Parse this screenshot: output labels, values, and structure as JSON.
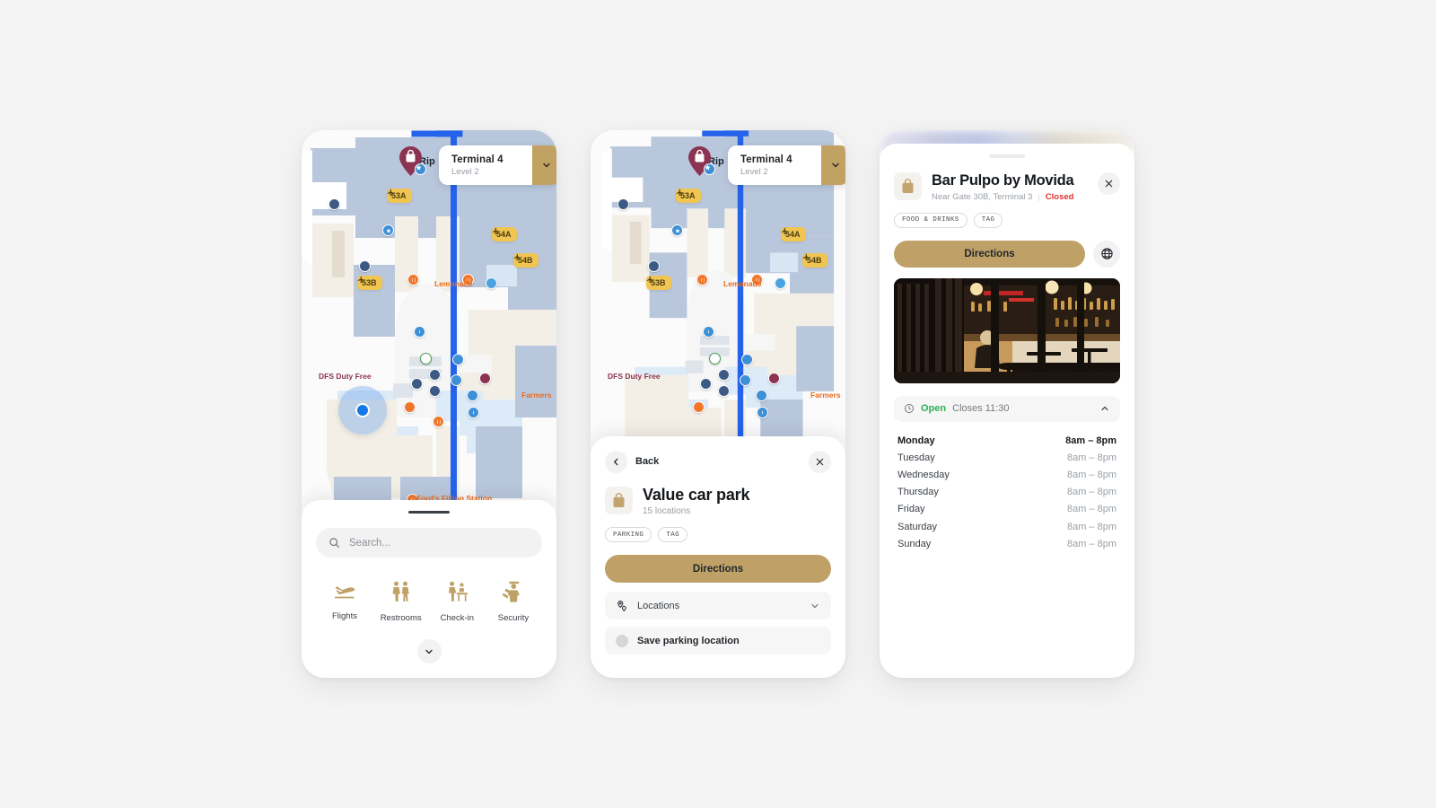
{
  "app": {
    "background": "#f4f4f4",
    "accent": "#bfa167"
  },
  "map": {
    "terminal": {
      "name": "Terminal 4",
      "level": "Level 2",
      "caret_icon": "chevron-down-icon"
    },
    "rip_label": "Rip",
    "pin_icon": "shopping-bag-pin-icon",
    "gates": [
      {
        "label": "53A",
        "icon": "plane-icon"
      },
      {
        "label": "54A",
        "icon": "plane-icon"
      },
      {
        "label": "54B",
        "icon": "plane-icon"
      },
      {
        "label": "53B",
        "icon": "plane-icon"
      }
    ],
    "labels": [
      {
        "text": "Lemonade",
        "color": "orange"
      },
      {
        "text": "DFS Duty Free",
        "color": "maroon"
      },
      {
        "text": "Farmers",
        "color": "orange"
      },
      {
        "text": "Ford's Filling Station",
        "color": "orange"
      }
    ],
    "locate_icon": "crosshair-locate-icon",
    "user_location": "you-are-here-dot"
  },
  "sheet1": {
    "search": {
      "placeholder": "Search...",
      "icon": "search-icon"
    },
    "quick_actions": [
      {
        "label": "Flights",
        "icon": "plane-landing-icon"
      },
      {
        "label": "Restrooms",
        "icon": "restrooms-icon"
      },
      {
        "label": "Check-in",
        "icon": "check-in-desk-icon"
      },
      {
        "label": "Security",
        "icon": "security-officer-icon"
      }
    ],
    "expand_icon": "chevron-down-icon"
  },
  "sheet2": {
    "back_label": "Back",
    "back_icon": "chevron-left-icon",
    "close_icon": "close-icon",
    "title": "Value car park",
    "subtitle": "15 locations",
    "thumb_icon": "shopping-bag-icon",
    "tags": [
      "PARKING",
      "TAG"
    ],
    "directions_label": "Directions",
    "locations_label": "Locations",
    "locations_icon": "map-pins-icon",
    "locations_caret": "chevron-down-icon",
    "save_parking_label": "Save parking location",
    "save_parking_toggle": "toggle-dot"
  },
  "detail": {
    "title": "Bar Pulpo by Movida",
    "location": "Near Gate 30B, Terminal 3",
    "status": "Closed",
    "status_color": "#e03232",
    "thumb_icon": "shopping-bag-icon",
    "close_icon": "close-icon",
    "tags": [
      "FOOD & DRINKS",
      "TAG"
    ],
    "directions_label": "Directions",
    "website_icon": "globe-icon",
    "photo_alt": "bar-interior-photo",
    "hours_header": {
      "clock_icon": "clock-icon",
      "state": "Open",
      "state_color": "#2db055",
      "detail": "Closes 11:30",
      "collapse_icon": "chevron-up-icon"
    },
    "hours": [
      {
        "day": "Monday",
        "value": "8am – 8pm",
        "today": true
      },
      {
        "day": "Tuesday",
        "value": "8am – 8pm",
        "today": false
      },
      {
        "day": "Wednesday",
        "value": "8am – 8pm",
        "today": false
      },
      {
        "day": "Thursday",
        "value": "8am – 8pm",
        "today": false
      },
      {
        "day": "Friday",
        "value": "8am – 8pm",
        "today": false
      },
      {
        "day": "Saturday",
        "value": "8am – 8pm",
        "today": false
      },
      {
        "day": "Sunday",
        "value": "8am – 8pm",
        "today": false
      }
    ]
  }
}
